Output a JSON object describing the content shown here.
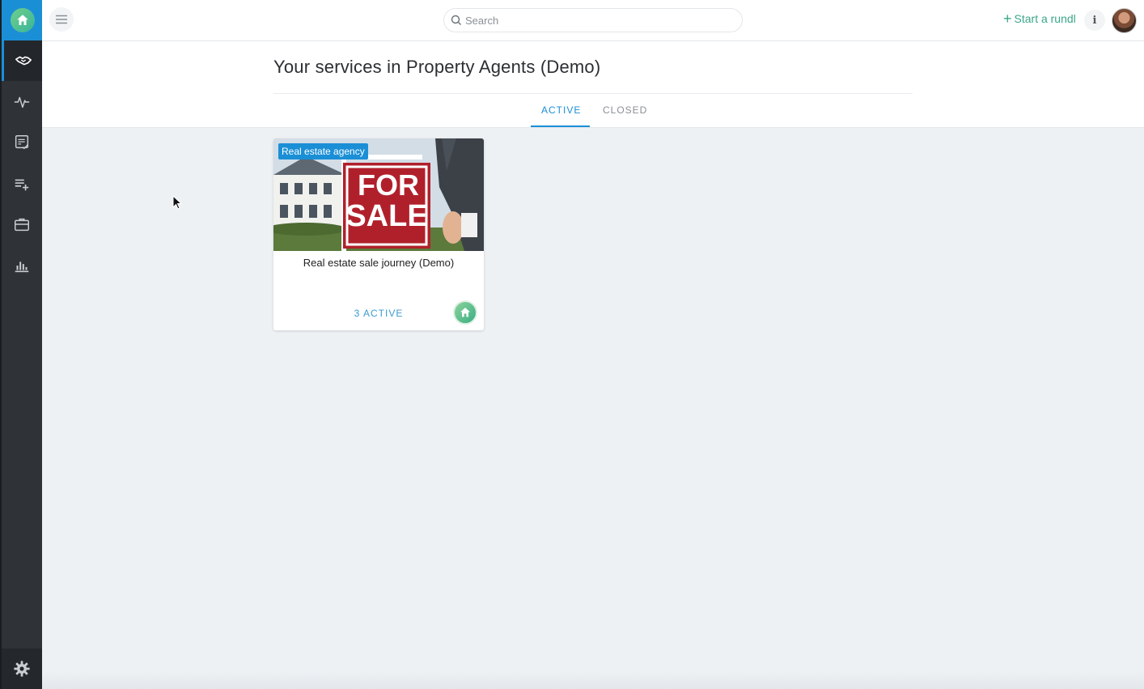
{
  "topbar": {
    "search_placeholder": "Search",
    "start_rundl_label": "Start a rundl",
    "info_label": "i"
  },
  "sidebar": {
    "items": [
      {
        "icon": "handshake-icon",
        "active": true
      },
      {
        "icon": "activity-icon",
        "active": false
      },
      {
        "icon": "checklist-icon",
        "active": false
      },
      {
        "icon": "add-list-icon",
        "active": false
      },
      {
        "icon": "briefcase-icon",
        "active": false
      },
      {
        "icon": "bar-chart-icon",
        "active": false
      }
    ],
    "settings_icon": "gear-icon"
  },
  "header": {
    "title": "Your services in Property Agents (Demo)",
    "tabs": [
      {
        "label": "ACTIVE",
        "selected": true
      },
      {
        "label": "CLOSED",
        "selected": false
      }
    ]
  },
  "cards": [
    {
      "tag": "Real estate agency",
      "title": "Real estate sale journey (Demo)",
      "count_label": "3 ACTIVE",
      "sign_line1": "FOR",
      "sign_line2": "SALE"
    }
  ],
  "colors": {
    "accent": "#1b8fd6",
    "green": "#3aa68a",
    "sidebar": "#2f3338"
  }
}
